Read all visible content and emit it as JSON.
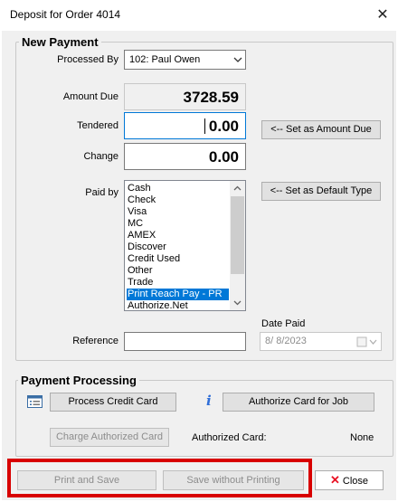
{
  "window": {
    "title": "Deposit for Order 4014",
    "close_glyph": "✕"
  },
  "new_payment": {
    "group_title": "New Payment",
    "processed_by_label": "Processed By",
    "processed_by_value": "102: Paul Owen",
    "amount_due_label": "Amount Due",
    "amount_due_value": "3728.59",
    "tendered_label": "Tendered",
    "tendered_value": "0.00",
    "change_label": "Change",
    "change_value": "0.00",
    "set_amount_due_button": "<-- Set as Amount Due",
    "paid_by_label": "Paid by",
    "set_default_type_button": "<-- Set as Default Type",
    "payment_types": [
      "Cash",
      "Check",
      "Visa",
      "MC",
      "AMEX",
      "Discover",
      "Credit Used",
      "Other",
      "Trade",
      "Print Reach Pay - PR",
      "Authorize.Net"
    ],
    "selected_payment_type": "Print Reach Pay - PR",
    "reference_label": "Reference",
    "reference_value": "",
    "date_paid_label": "Date Paid",
    "date_paid_value": "8/  8/2023"
  },
  "payment_processing": {
    "group_title": "Payment Processing",
    "process_credit_card_button": "Process Credit Card",
    "authorize_card_button": "Authorize Card for Job",
    "charge_authorized_card_button": "Charge Authorized Card",
    "authorized_card_label": "Authorized Card:",
    "authorized_card_value": "None"
  },
  "footer": {
    "print_and_save_button": "Print and Save",
    "save_without_printing_button": "Save without Printing",
    "close_button": "Close",
    "close_icon_glyph": "✕"
  },
  "colors": {
    "highlight_red": "#d80000",
    "selection_blue": "#0078d7",
    "info_icon": "#2f6ed8",
    "close_x_red": "#e81123"
  }
}
